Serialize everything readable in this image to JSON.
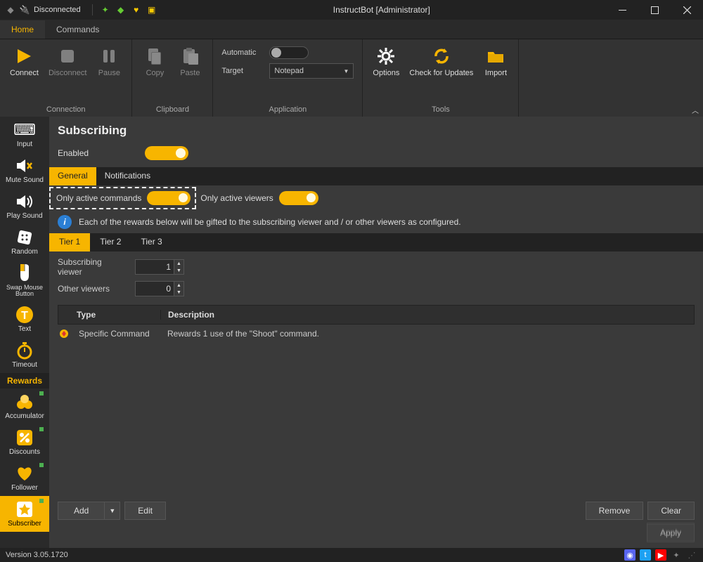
{
  "titlebar": {
    "status": "Disconnected",
    "title": "InstructBot [Administrator]"
  },
  "menu": {
    "tabs": [
      "Home",
      "Commands"
    ],
    "active": 0
  },
  "ribbon": {
    "connection": {
      "label": "Connection",
      "connect": "Connect",
      "disconnect": "Disconnect",
      "pause": "Pause"
    },
    "clipboard": {
      "label": "Clipboard",
      "copy": "Copy",
      "paste": "Paste"
    },
    "application": {
      "label": "Application",
      "automatic": "Automatic",
      "target": "Target",
      "target_value": "Notepad"
    },
    "tools": {
      "label": "Tools",
      "options": "Options",
      "check": "Check for Updates",
      "import": "Import"
    }
  },
  "sidebar": {
    "items": [
      {
        "label": "Input"
      },
      {
        "label": "Mute Sound"
      },
      {
        "label": "Play Sound"
      },
      {
        "label": "Random"
      },
      {
        "label": "Swap Mouse Button"
      },
      {
        "label": "Text"
      },
      {
        "label": "Timeout"
      }
    ],
    "rewards_header": "Rewards",
    "rewards": [
      {
        "label": "Accumulator"
      },
      {
        "label": "Discounts"
      },
      {
        "label": "Follower"
      },
      {
        "label": "Subscriber"
      }
    ]
  },
  "content": {
    "title": "Subscribing",
    "enabled_label": "Enabled",
    "subtabs": [
      "General",
      "Notifications"
    ],
    "only_active_commands": "Only active commands",
    "only_active_viewers": "Only active viewers",
    "info_text": "Each of the rewards below will be gifted to the subscribing viewer and / or other viewers as configured.",
    "tier_tabs": [
      "Tier 1",
      "Tier 2",
      "Tier 3"
    ],
    "subscribing_viewer_label": "Subscribing viewer",
    "subscribing_viewer_value": "1",
    "other_viewers_label": "Other viewers",
    "other_viewers_value": "0",
    "table": {
      "headers": {
        "type": "Type",
        "desc": "Description"
      },
      "rows": [
        {
          "type": "Specific Command",
          "desc": "Rewards 1 use of the \"Shoot\" command."
        }
      ]
    },
    "buttons": {
      "add": "Add",
      "edit": "Edit",
      "remove": "Remove",
      "clear": "Clear",
      "apply": "Apply"
    }
  },
  "statusbar": {
    "version": "Version 3.05.1720"
  }
}
